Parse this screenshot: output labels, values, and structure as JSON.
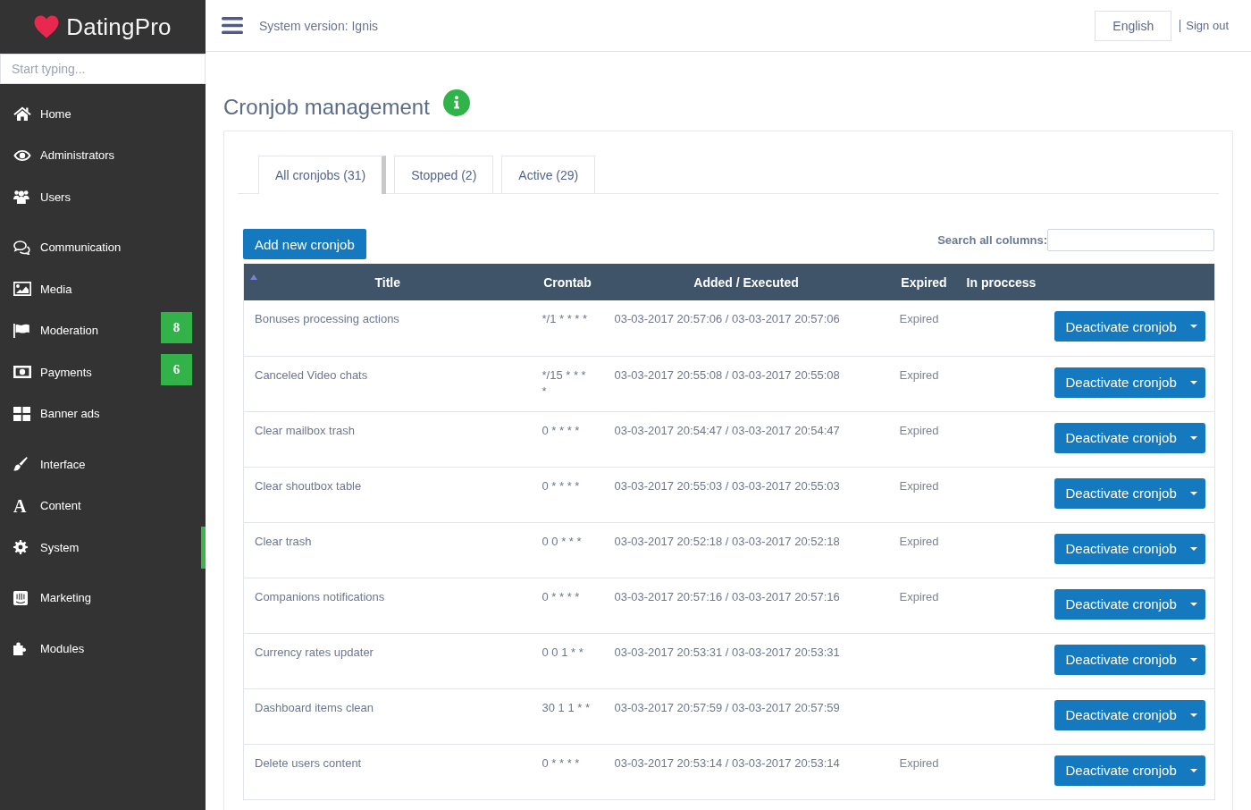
{
  "logo": {
    "text": "DatingPro"
  },
  "sidebar": {
    "search": {
      "placeholder": "Start typing..."
    },
    "groups": [
      {
        "items": [
          {
            "label": "Home",
            "selected": false
          },
          {
            "label": "Administrators",
            "selected": false
          },
          {
            "label": "Users",
            "selected": false
          }
        ]
      },
      {
        "items": [
          {
            "label": "Communication",
            "selected": false
          },
          {
            "label": "Media",
            "selected": false
          },
          {
            "label": "Moderation",
            "selected": false,
            "badge": "8"
          },
          {
            "label": "Payments",
            "selected": false,
            "badge": "6"
          },
          {
            "label": "Banner ads",
            "selected": false
          }
        ]
      },
      {
        "items": [
          {
            "label": "Interface",
            "selected": false
          },
          {
            "label": "Content",
            "selected": false,
            "glyph": "A"
          },
          {
            "label": "System",
            "selected": true
          }
        ]
      },
      {
        "items": [
          {
            "label": "Marketing",
            "selected": false
          }
        ]
      },
      {
        "items": [
          {
            "label": "Modules",
            "selected": false
          }
        ]
      }
    ]
  },
  "topbar": {
    "version": "System version: Ignis",
    "language": "English",
    "sign_out": "Sign out"
  },
  "page": {
    "title": "Cronjob management"
  },
  "tabs": [
    {
      "label": "All cronjobs (31)",
      "selected": true
    },
    {
      "label": "Stopped (2)",
      "selected": false
    },
    {
      "label": "Active (29)",
      "selected": false
    }
  ],
  "toolbar": {
    "add_button": "Add new cronjob",
    "search_label": "Search all columns:"
  },
  "table": {
    "columns": [
      {
        "label": "Title",
        "sorted": true
      },
      {
        "label": "Crontab",
        "sorted": false
      },
      {
        "label": "Added / Executed",
        "sorted": false
      },
      {
        "label": "Expired",
        "sorted": false
      },
      {
        "label": "In proccess",
        "sorted": false
      }
    ],
    "rows": [
      {
        "title": "Bonuses processing actions",
        "crontab": "*/1 * * * *",
        "added_executed": "03-03-2017 20:57:06 / 03-03-2017 20:57:06",
        "expired": "Expired",
        "action": "Deactivate cronjob"
      },
      {
        "title": "Canceled Video chats",
        "crontab": "*/15 * * * *",
        "added_executed": "03-03-2017 20:55:08 / 03-03-2017 20:55:08",
        "expired": "Expired",
        "action": "Deactivate cronjob"
      },
      {
        "title": "Clear mailbox trash",
        "crontab": "0 * * * *",
        "added_executed": "03-03-2017 20:54:47 / 03-03-2017 20:54:47",
        "expired": "Expired",
        "action": "Deactivate cronjob"
      },
      {
        "title": "Clear shoutbox table",
        "crontab": "0 * * * *",
        "added_executed": "03-03-2017 20:55:03 / 03-03-2017 20:55:03",
        "expired": "Expired",
        "action": "Deactivate cronjob"
      },
      {
        "title": "Clear trash",
        "crontab": "0 0 * * *",
        "added_executed": "03-03-2017 20:52:18 / 03-03-2017 20:52:18",
        "expired": "Expired",
        "action": "Deactivate cronjob"
      },
      {
        "title": "Companions notifications",
        "crontab": "0 * * * *",
        "added_executed": "03-03-2017 20:57:16 / 03-03-2017 20:57:16",
        "expired": "Expired",
        "action": "Deactivate cronjob"
      },
      {
        "title": "Currency rates updater",
        "crontab": "0 0 1 * *",
        "added_executed": "03-03-2017 20:53:31 / 03-03-2017 20:53:31",
        "action": "Deactivate cronjob"
      },
      {
        "title": "Dashboard items clean",
        "crontab": "30 1 1 * *",
        "added_executed": "03-03-2017 20:57:59 / 03-03-2017 20:57:59",
        "action": "Deactivate cronjob"
      },
      {
        "title": "Delete users content",
        "crontab": "0 * * * *",
        "added_executed": "03-03-2017 20:53:14 / 03-03-2017 20:53:14",
        "expired": "Expired",
        "action": "Deactivate cronjob"
      }
    ]
  }
}
